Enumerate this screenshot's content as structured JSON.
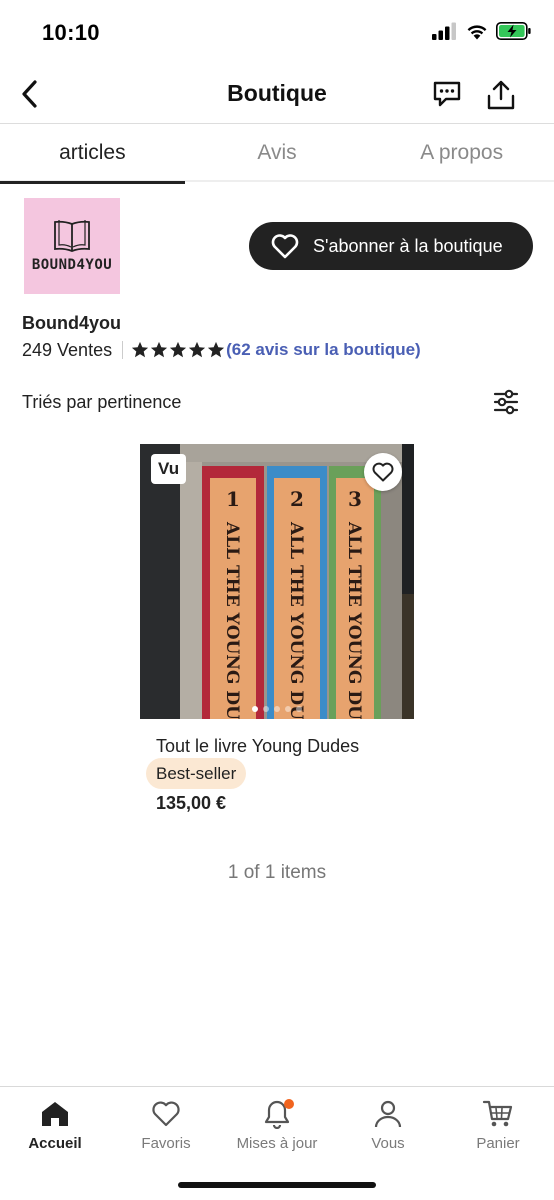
{
  "status_bar": {
    "time": "10:10"
  },
  "nav": {
    "title": "Boutique"
  },
  "tabs": [
    {
      "label": "articles",
      "active": true
    },
    {
      "label": "Avis",
      "active": false
    },
    {
      "label": "A propos",
      "active": false
    }
  ],
  "shop": {
    "logo_text": "BOUND4YOU",
    "name": "Bound4you",
    "sales": "249 Ventes",
    "rating_stars": 5,
    "reviews_link": "(62 avis sur la boutique)",
    "follow_label": "S'abonner à la boutique"
  },
  "sort": {
    "label": "Triés par pertinence"
  },
  "product": {
    "seen_badge": "Vu",
    "title": "Tout le livre Young Dudes",
    "badge": "Best-seller",
    "price": "135,00 €",
    "image_count": 5,
    "image_index": 1,
    "book_spines": [
      {
        "number": "1",
        "text": "ALL THE YOUNG DUDES",
        "color": "#b3283a"
      },
      {
        "number": "2",
        "text": "ALL THE YOUNG DUDES",
        "color": "#3c8cc8"
      },
      {
        "number": "3",
        "text": "ALL THE YOUNG DUDES",
        "color": "#6aa05a"
      }
    ]
  },
  "pagination": {
    "text": "1 of 1 items"
  },
  "bottom_nav": [
    {
      "label": "Accueil",
      "icon": "home-icon",
      "active": true
    },
    {
      "label": "Favoris",
      "icon": "heart-icon",
      "active": false
    },
    {
      "label": "Mises à jour",
      "icon": "bell-icon",
      "active": false,
      "has_notification": true
    },
    {
      "label": "Vous",
      "icon": "person-icon",
      "active": false
    },
    {
      "label": "Panier",
      "icon": "cart-icon",
      "active": false
    }
  ],
  "colors": {
    "accent_link": "#4a5fb4",
    "button_dark": "#222222",
    "bestseller_bg": "#fbe8d3",
    "notification": "#f1641e",
    "logo_bg": "#f4c6df",
    "battery_charging": "#34c759"
  }
}
